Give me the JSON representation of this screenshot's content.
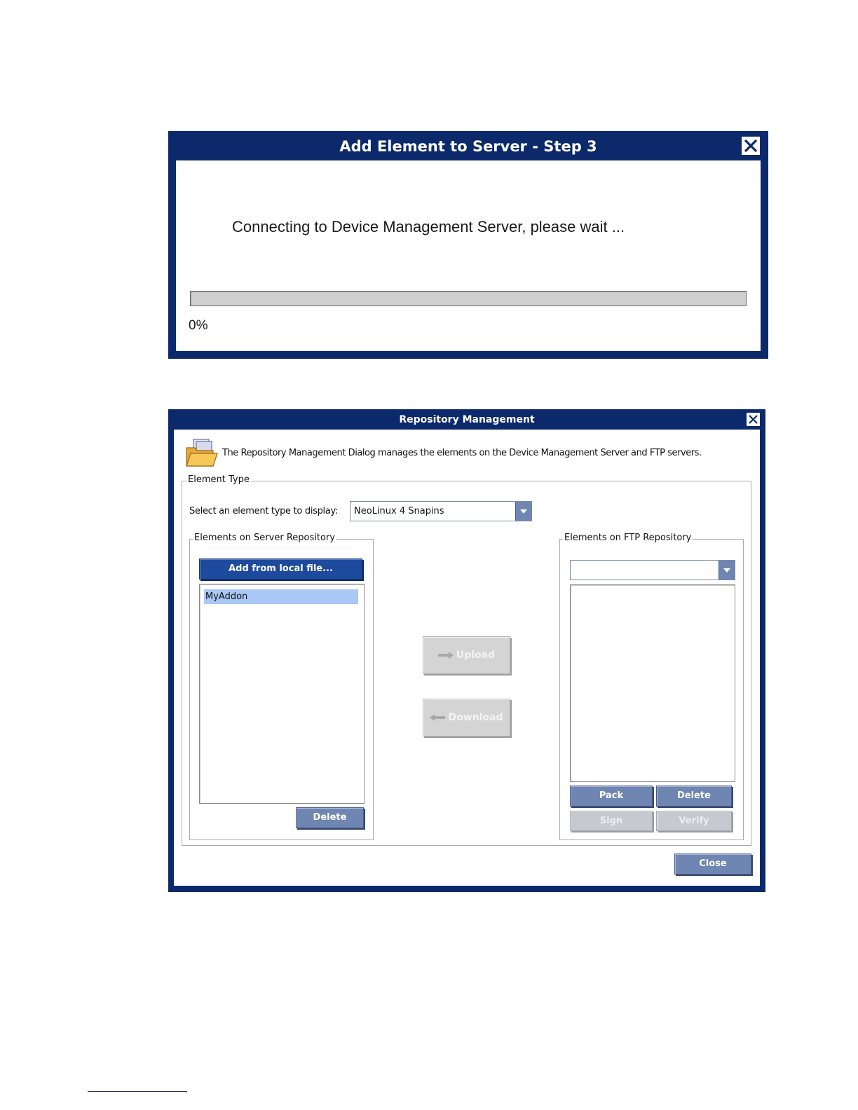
{
  "step_dialog": {
    "title": "Add Element to Server - Step 3",
    "message": "Connecting to Device Management Server, please wait ...",
    "progress": 0,
    "progress_label": "0%",
    "close_icon": "close-icon"
  },
  "repo_dialog": {
    "title": "Repository Management",
    "description": "The Repository Management Dialog manages the elements on the Device Management Server and FTP servers.",
    "header_icon": "folder-icon",
    "element_type": {
      "legend": "Element Type",
      "select_label": "Select an element type to display:",
      "select_value": "NeoLinux 4 Snapins"
    },
    "server_repo": {
      "legend": "Elements on Server Repository",
      "add_button": "Add from local file...",
      "items": [
        "MyAddon"
      ],
      "selected": "MyAddon",
      "delete_button": "Delete"
    },
    "transfer": {
      "upload_button": "Upload",
      "download_button": "Download"
    },
    "ftp_repo": {
      "legend": "Elements on FTP Repository",
      "combo_value": "",
      "pack_button": "Pack",
      "delete_button": "Delete",
      "sign_button": "Sign",
      "verify_button": "Verify"
    },
    "close_button": "Close"
  },
  "colors": {
    "title_bar": "#0c2a6b",
    "button_blue": "#6f86b3",
    "button_dark": "#1e4a9e",
    "selection": "#a9c8f5"
  }
}
